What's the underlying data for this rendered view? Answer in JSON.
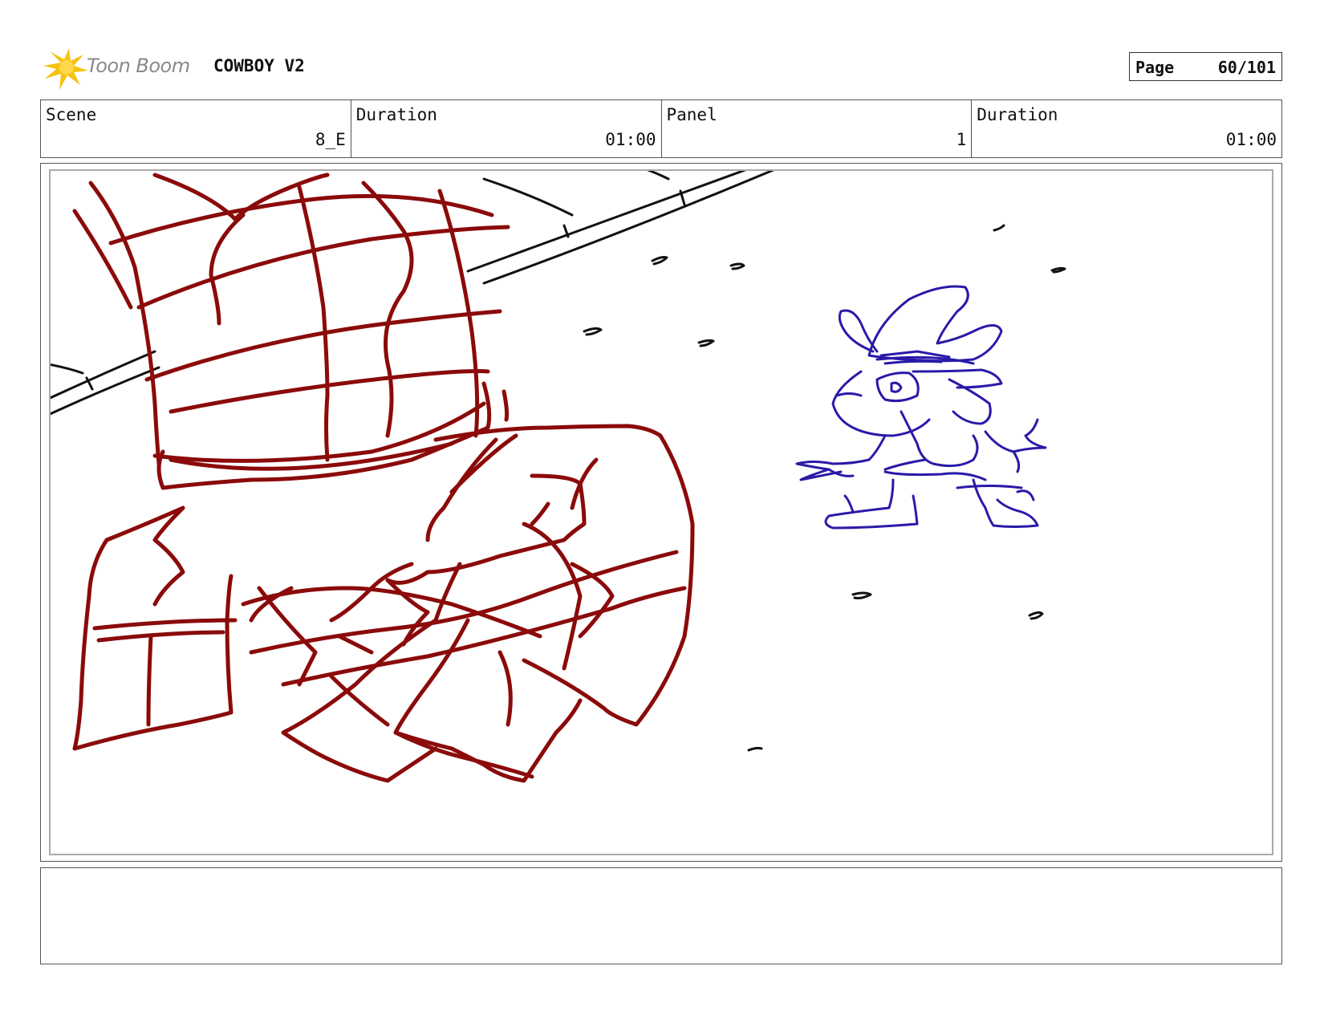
{
  "header": {
    "logo_text": "Toon Boom",
    "project_title": "COWBOY V2",
    "page_label": "Page",
    "page_value": "60/101"
  },
  "info": {
    "scene_label": "Scene",
    "scene_value": "8_E",
    "scene_duration_label": "Duration",
    "scene_duration_value": "01:00",
    "panel_label": "Panel",
    "panel_value": "1",
    "panel_duration_label": "Duration",
    "panel_duration_value": "01:00"
  },
  "colors": {
    "foreground_sketch": "#8b0a0a",
    "character_sketch": "#2a1aa8",
    "background_lines": "#111111",
    "logo_accent": "#f7c20f"
  },
  "notes": {
    "text": ""
  }
}
